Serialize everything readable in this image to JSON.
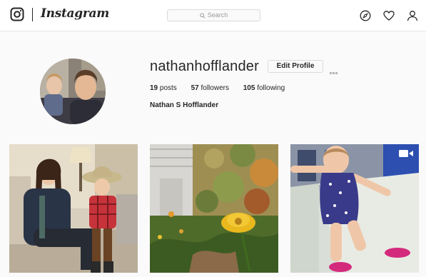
{
  "header": {
    "wordmark": "Instagram",
    "search_placeholder": "Search",
    "icons": [
      "instagram-camera-icon",
      "search-icon",
      "compass-explore-icon",
      "heart-activity-icon",
      "person-profile-icon"
    ]
  },
  "profile": {
    "username": "nathanhofflander",
    "edit_button": "Edit Profile",
    "more_icon": "more-options-icon",
    "stats": {
      "posts_count": "19",
      "posts_label": "posts",
      "followers_count": "57",
      "followers_label": "followers",
      "following_count": "105",
      "following_label": "following"
    },
    "full_name": "Nathan S Hofflander"
  },
  "posts": [
    {
      "type": "photo"
    },
    {
      "type": "photo"
    },
    {
      "type": "video",
      "badge_icon": "video-camera-icon"
    }
  ],
  "colors": {
    "background": "#fafafa",
    "text": "#262626",
    "border": "#dbdbdb",
    "video_badge": "#ffffff"
  }
}
